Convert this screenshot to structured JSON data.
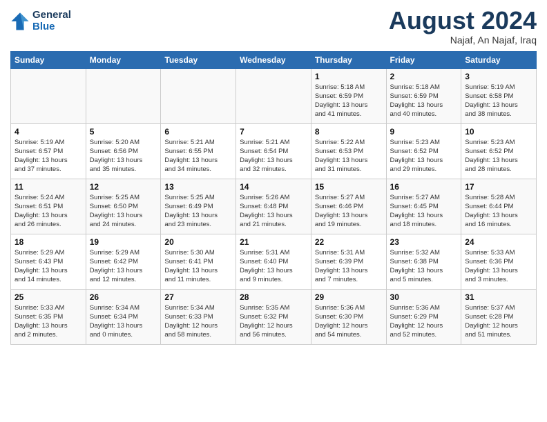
{
  "header": {
    "logo_line1": "General",
    "logo_line2": "Blue",
    "month_year": "August 2024",
    "location": "Najaf, An Najaf, Iraq"
  },
  "days_of_week": [
    "Sunday",
    "Monday",
    "Tuesday",
    "Wednesday",
    "Thursday",
    "Friday",
    "Saturday"
  ],
  "weeks": [
    [
      {
        "day": "",
        "info": ""
      },
      {
        "day": "",
        "info": ""
      },
      {
        "day": "",
        "info": ""
      },
      {
        "day": "",
        "info": ""
      },
      {
        "day": "1",
        "info": "Sunrise: 5:18 AM\nSunset: 6:59 PM\nDaylight: 13 hours\nand 41 minutes."
      },
      {
        "day": "2",
        "info": "Sunrise: 5:18 AM\nSunset: 6:59 PM\nDaylight: 13 hours\nand 40 minutes."
      },
      {
        "day": "3",
        "info": "Sunrise: 5:19 AM\nSunset: 6:58 PM\nDaylight: 13 hours\nand 38 minutes."
      }
    ],
    [
      {
        "day": "4",
        "info": "Sunrise: 5:19 AM\nSunset: 6:57 PM\nDaylight: 13 hours\nand 37 minutes."
      },
      {
        "day": "5",
        "info": "Sunrise: 5:20 AM\nSunset: 6:56 PM\nDaylight: 13 hours\nand 35 minutes."
      },
      {
        "day": "6",
        "info": "Sunrise: 5:21 AM\nSunset: 6:55 PM\nDaylight: 13 hours\nand 34 minutes."
      },
      {
        "day": "7",
        "info": "Sunrise: 5:21 AM\nSunset: 6:54 PM\nDaylight: 13 hours\nand 32 minutes."
      },
      {
        "day": "8",
        "info": "Sunrise: 5:22 AM\nSunset: 6:53 PM\nDaylight: 13 hours\nand 31 minutes."
      },
      {
        "day": "9",
        "info": "Sunrise: 5:23 AM\nSunset: 6:52 PM\nDaylight: 13 hours\nand 29 minutes."
      },
      {
        "day": "10",
        "info": "Sunrise: 5:23 AM\nSunset: 6:52 PM\nDaylight: 13 hours\nand 28 minutes."
      }
    ],
    [
      {
        "day": "11",
        "info": "Sunrise: 5:24 AM\nSunset: 6:51 PM\nDaylight: 13 hours\nand 26 minutes."
      },
      {
        "day": "12",
        "info": "Sunrise: 5:25 AM\nSunset: 6:50 PM\nDaylight: 13 hours\nand 24 minutes."
      },
      {
        "day": "13",
        "info": "Sunrise: 5:25 AM\nSunset: 6:49 PM\nDaylight: 13 hours\nand 23 minutes."
      },
      {
        "day": "14",
        "info": "Sunrise: 5:26 AM\nSunset: 6:48 PM\nDaylight: 13 hours\nand 21 minutes."
      },
      {
        "day": "15",
        "info": "Sunrise: 5:27 AM\nSunset: 6:46 PM\nDaylight: 13 hours\nand 19 minutes."
      },
      {
        "day": "16",
        "info": "Sunrise: 5:27 AM\nSunset: 6:45 PM\nDaylight: 13 hours\nand 18 minutes."
      },
      {
        "day": "17",
        "info": "Sunrise: 5:28 AM\nSunset: 6:44 PM\nDaylight: 13 hours\nand 16 minutes."
      }
    ],
    [
      {
        "day": "18",
        "info": "Sunrise: 5:29 AM\nSunset: 6:43 PM\nDaylight: 13 hours\nand 14 minutes."
      },
      {
        "day": "19",
        "info": "Sunrise: 5:29 AM\nSunset: 6:42 PM\nDaylight: 13 hours\nand 12 minutes."
      },
      {
        "day": "20",
        "info": "Sunrise: 5:30 AM\nSunset: 6:41 PM\nDaylight: 13 hours\nand 11 minutes."
      },
      {
        "day": "21",
        "info": "Sunrise: 5:31 AM\nSunset: 6:40 PM\nDaylight: 13 hours\nand 9 minutes."
      },
      {
        "day": "22",
        "info": "Sunrise: 5:31 AM\nSunset: 6:39 PM\nDaylight: 13 hours\nand 7 minutes."
      },
      {
        "day": "23",
        "info": "Sunrise: 5:32 AM\nSunset: 6:38 PM\nDaylight: 13 hours\nand 5 minutes."
      },
      {
        "day": "24",
        "info": "Sunrise: 5:33 AM\nSunset: 6:36 PM\nDaylight: 13 hours\nand 3 minutes."
      }
    ],
    [
      {
        "day": "25",
        "info": "Sunrise: 5:33 AM\nSunset: 6:35 PM\nDaylight: 13 hours\nand 2 minutes."
      },
      {
        "day": "26",
        "info": "Sunrise: 5:34 AM\nSunset: 6:34 PM\nDaylight: 13 hours\nand 0 minutes."
      },
      {
        "day": "27",
        "info": "Sunrise: 5:34 AM\nSunset: 6:33 PM\nDaylight: 12 hours\nand 58 minutes."
      },
      {
        "day": "28",
        "info": "Sunrise: 5:35 AM\nSunset: 6:32 PM\nDaylight: 12 hours\nand 56 minutes."
      },
      {
        "day": "29",
        "info": "Sunrise: 5:36 AM\nSunset: 6:30 PM\nDaylight: 12 hours\nand 54 minutes."
      },
      {
        "day": "30",
        "info": "Sunrise: 5:36 AM\nSunset: 6:29 PM\nDaylight: 12 hours\nand 52 minutes."
      },
      {
        "day": "31",
        "info": "Sunrise: 5:37 AM\nSunset: 6:28 PM\nDaylight: 12 hours\nand 51 minutes."
      }
    ]
  ]
}
